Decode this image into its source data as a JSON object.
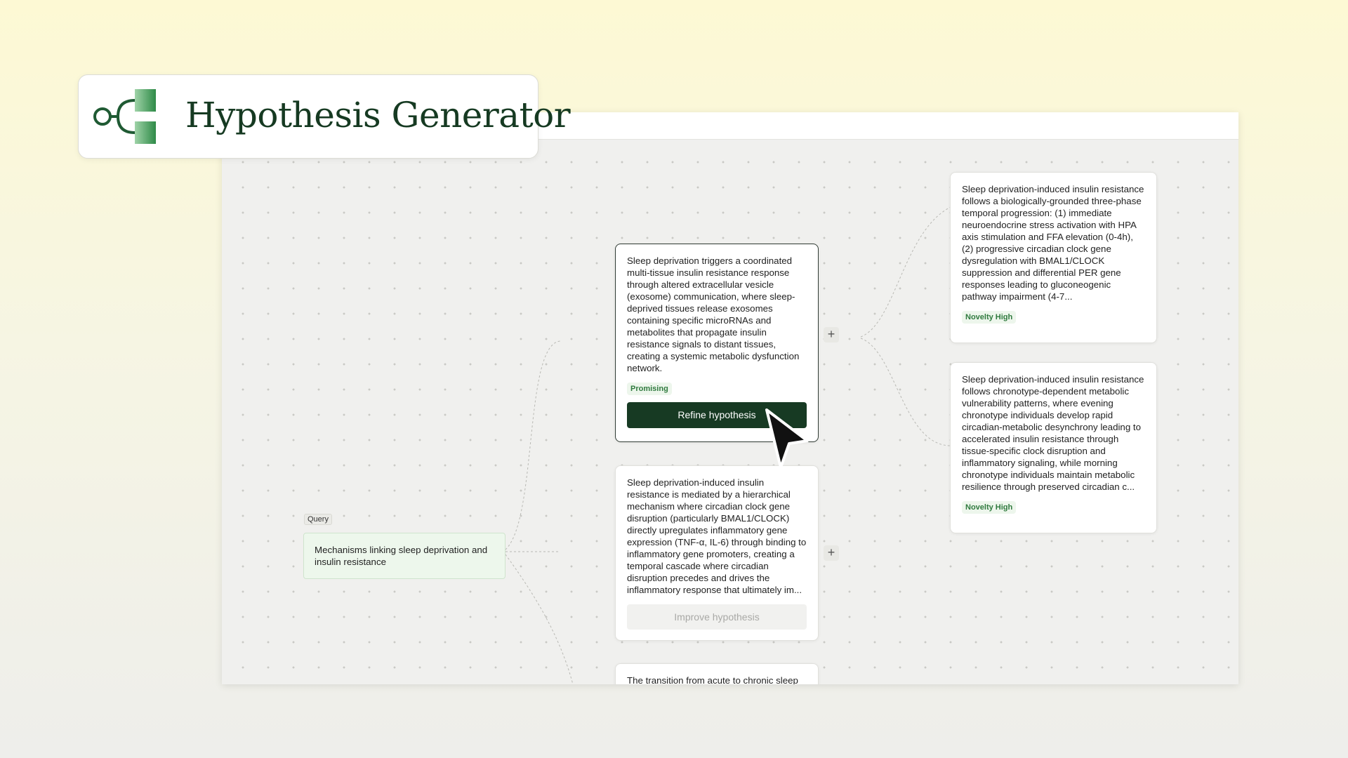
{
  "app": {
    "title": "Hypothesis Generator"
  },
  "query": {
    "tag": "Query",
    "text": "Mechanisms linking sleep deprivation and insulin resistance"
  },
  "hypotheses": [
    {
      "text": "Sleep deprivation triggers a coordinated multi-tissue insulin resistance response through altered extracellular vesicle (exosome) communication, where sleep-deprived tissues release exosomes containing specific microRNAs and metabolites that propagate insulin resistance signals to distant tissues, creating a systemic metabolic dysfunction network.",
      "badge": "Promising",
      "action": "Refine hypothesis"
    },
    {
      "text": "Sleep deprivation-induced insulin resistance is mediated by a hierarchical mechanism where circadian clock gene disruption (particularly BMAL1/CLOCK) directly upregulates inflammatory gene expression (TNF-α, IL-6) through binding to inflammatory gene promoters, creating a temporal cascade where circadian disruption precedes and drives the inflammatory response that ultimately im...",
      "action": "Improve hypothesis"
    },
    {
      "text": "The transition from acute to chronic sleep"
    }
  ],
  "refinements": [
    {
      "text": "Sleep deprivation-induced insulin resistance follows a biologically-grounded three-phase temporal progression: (1) immediate neuroendocrine stress activation with HPA axis stimulation and FFA elevation (0-4h), (2) progressive circadian clock gene dysregulation with BMAL1/CLOCK suppression and differential PER gene responses leading to gluconeogenic pathway impairment (4-7...",
      "badge": "Novelty High"
    },
    {
      "text": "Sleep deprivation-induced insulin resistance follows chronotype-dependent metabolic vulnerability patterns, where evening chronotype individuals develop rapid circadian-metabolic desynchrony leading to accelerated insulin resistance through tissue-specific clock disruption and inflammatory signaling, while morning chronotype individuals maintain metabolic resilience through preserved circadian c...",
      "badge": "Novelty High"
    }
  ],
  "icons": {
    "expand": "plus-icon",
    "pointer": "cursor-arrow-icon",
    "logo": "tree-branch-logo"
  },
  "colors": {
    "brand_dark_green": "#173a23",
    "badge_green": "#2f7a3e",
    "query_bg": "#edf7ec"
  },
  "plus_glyph": "+"
}
